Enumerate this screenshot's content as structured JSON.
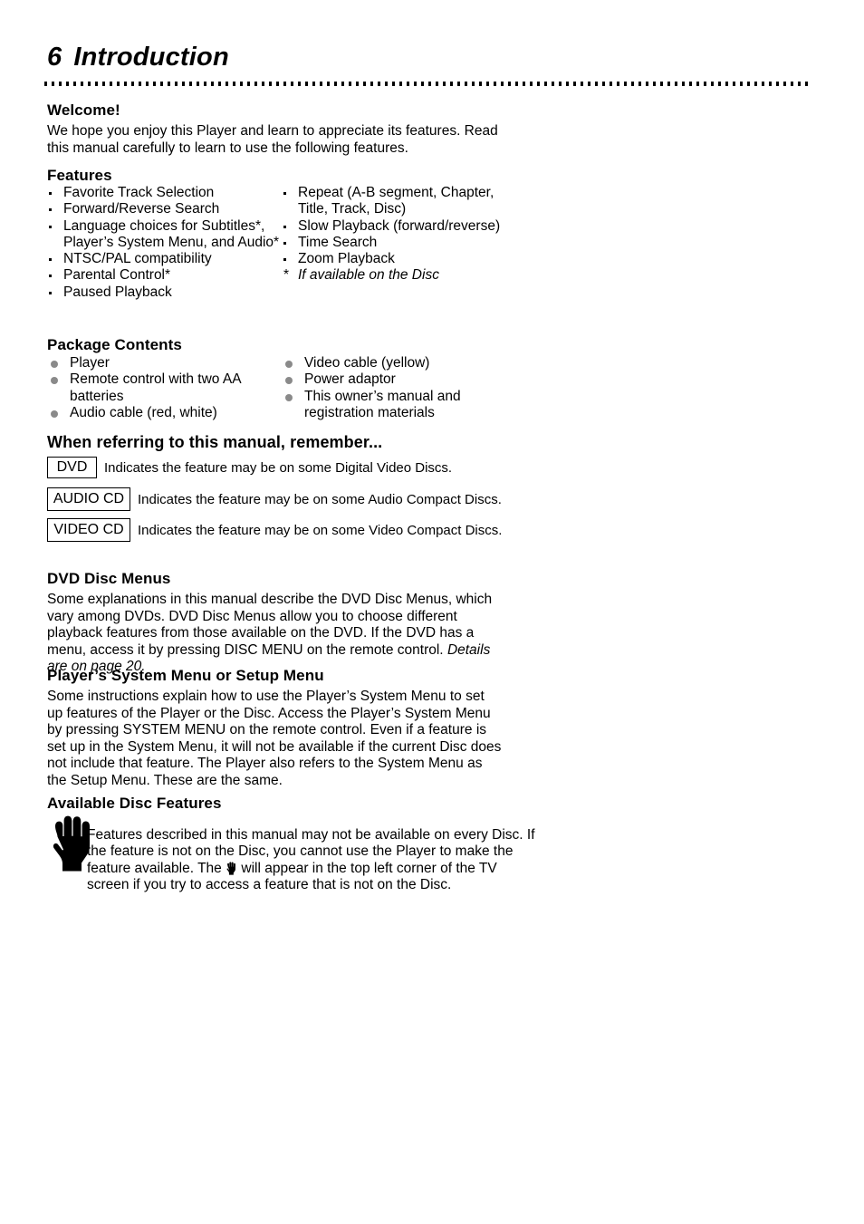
{
  "page": {
    "number": "6",
    "title": "Introduction"
  },
  "welcome": {
    "heading": "Welcome!",
    "body": "We hope you enjoy this Player and learn to appreciate its features. Read this manual carefully to learn to use the following features."
  },
  "features": {
    "heading": "Features",
    "left_items": [
      "Favorite Track Selection",
      "Forward/Reverse Search",
      "Language choices for Subtitles*, Player’s System Menu, and Audio*",
      "NTSC/PAL compatibility",
      "Parental Control*",
      "Paused Playback"
    ],
    "right_items": [
      "Repeat (A-B segment, Chapter, Title, Track, Disc)",
      "Slow Playback (forward/reverse)",
      "Time Search",
      "Zoom Playback"
    ],
    "footnote_marker": "*",
    "footnote": "If available on the Disc"
  },
  "package_contents": {
    "heading": "Package Contents",
    "left_items": [
      "Player",
      "Remote control with two AA batteries",
      "Audio cable (red, white)"
    ],
    "right_items": [
      "Video cable (yellow)",
      "Power adaptor",
      "This owner’s manual and registration materials"
    ]
  },
  "legend": {
    "heading": "When referring to this manual, remember...",
    "rows": [
      {
        "label": "DVD",
        "text": "Indicates the feature may be on some Digital Video Discs."
      },
      {
        "label": "AUDIO CD",
        "text": "Indicates the feature may be on some Audio Compact Discs."
      },
      {
        "label": "VIDEO CD",
        "text": "Indicates the feature may be on some Video Compact Discs."
      }
    ]
  },
  "disc_menus": {
    "heading": "DVD Disc Menus",
    "body": "Some explanations in this manual describe the DVD Disc Menus, which vary among DVDs. DVD Disc Menus allow you to choose different playback features from those available on the DVD. If the DVD has a menu, access it by pressing DISC MENU on the remote control. ",
    "italic_tail": "Details are on page 20."
  },
  "system_menu": {
    "heading": "Player’s System Menu or Setup Menu",
    "body": "Some instructions explain how to use the Player’s System Menu to set up features of the Player or the Disc. Access the Player’s System Menu by pressing SYSTEM MENU on the remote control. Even if a feature is set up in the System Menu, it will not be available if the current Disc does not include that feature. The Player also refers to the System Menu as the Setup Menu.  These are the same."
  },
  "available_features": {
    "heading": "Available Disc Features",
    "body_part1": "Features described in this manual may not be available on every Disc. If the feature is not on the Disc, you cannot use the Player to make the feature available. The ",
    "body_part2": " will appear in the top left corner of the TV screen if you try to access a feature that is not on the Disc."
  }
}
